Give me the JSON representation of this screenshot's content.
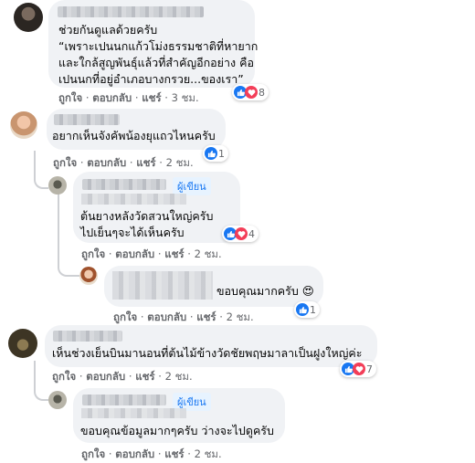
{
  "comments": [
    {
      "id": "c1",
      "lines": [
        "ช่วยกันดูแลด้วยครับ",
        "“เพราะเปนนกแก้วโม่งธรรมชาติที่หายาก",
        "และใกล้สูญพันธุ์แล้วที่สำคัญอีกอย่าง คือ",
        "เปนนกที่อยู่อำเภอบางกรวย...ของเรา”"
      ],
      "actions": {
        "like": "ถูกใจ",
        "reply": "ตอบกลับ",
        "share": "แชร์",
        "time": "3 ชม."
      },
      "reaction_count": "8"
    },
    {
      "id": "c2",
      "lines": [
        "อยากเห็นจังคัพน้องยุแถวไหนครับ"
      ],
      "actions": {
        "like": "ถูกใจ",
        "reply": "ตอบกลับ",
        "share": "แชร์",
        "time": "2 ชม."
      },
      "reaction_count": "1"
    },
    {
      "id": "c3",
      "badge": "ผู้เขียน",
      "lines": [
        "ต้นยางหลังวัดสวนใหญ่ครับ",
        "ไปเย็นๆจะได้เห็นครับ"
      ],
      "actions": {
        "like": "ถูกใจ",
        "reply": "ตอบกลับ",
        "share": "แชร์",
        "time": "2 ชม."
      },
      "reaction_count": "4"
    },
    {
      "id": "c4",
      "lines": [
        "ขอบคุณมากครับ 😍"
      ],
      "actions": {
        "like": "ถูกใจ",
        "reply": "ตอบกลับ",
        "share": "แชร์",
        "time": "2 ชม."
      },
      "reaction_count": "1"
    },
    {
      "id": "c5",
      "lines": [
        "เห็นช่วงเย็นบินมานอนที่ต้นไม้ข้างวัดชัยพฤษมาลาเป็นฝูงใหญ่ค่ะ"
      ],
      "actions": {
        "like": "ถูกใจ",
        "reply": "ตอบกลับ",
        "share": "แชร์",
        "time": "2 ชม."
      },
      "reaction_count": "7"
    },
    {
      "id": "c6",
      "badge": "ผู้เขียน",
      "lines": [
        "ขอบคุณข้อมูลมากๆครับ ว่างจะไปดูครับ"
      ],
      "actions": {
        "like": "ถูกใจ",
        "reply": "ตอบกลับ",
        "share": "แชร์",
        "time": "2 ชม."
      }
    }
  ],
  "colors": {
    "bubble": "#f0f2f5",
    "meta": "#65676b",
    "like": "#1877f2",
    "love": "#f33e58",
    "badge_bg": "#e7f3ff"
  }
}
